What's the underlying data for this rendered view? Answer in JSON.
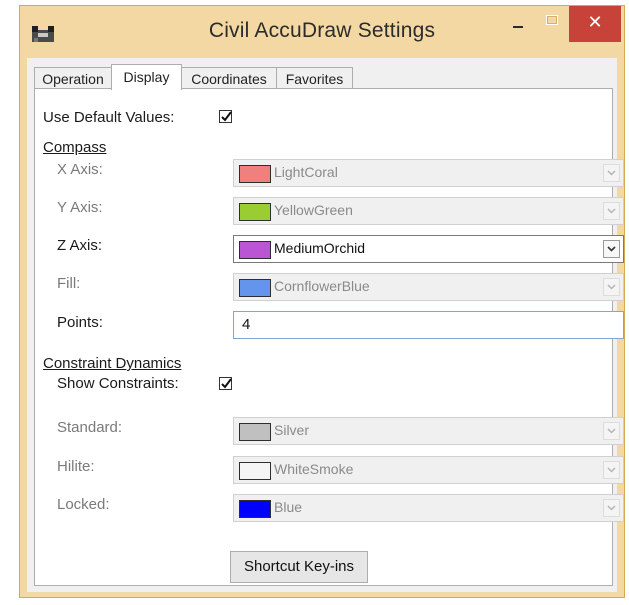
{
  "window": {
    "title": "Civil AccuDraw Settings",
    "minimize_glyph": "–",
    "close_glyph": "✕"
  },
  "tabs": [
    {
      "label": "Operation",
      "active": false
    },
    {
      "label": "Display",
      "active": true
    },
    {
      "label": "Coordinates",
      "active": false
    },
    {
      "label": "Favorites",
      "active": false
    }
  ],
  "display": {
    "use_default_values": {
      "label": "Use Default Values:",
      "checked": true
    },
    "compass": {
      "heading": "Compass",
      "x_axis": {
        "label": "X Axis:",
        "value": "LightCoral",
        "color": "#f08080",
        "enabled": false
      },
      "y_axis": {
        "label": "Y Axis:",
        "value": "YellowGreen",
        "color": "#9acd32",
        "enabled": false
      },
      "z_axis": {
        "label": "Z Axis:",
        "value": "MediumOrchid",
        "color": "#ba55d3",
        "enabled": true
      },
      "fill": {
        "label": "Fill:",
        "value": "CornflowerBlue",
        "color": "#6495ed",
        "enabled": false
      },
      "points": {
        "label": "Points:",
        "value": "4"
      }
    },
    "constraint_dynamics": {
      "heading": "Constraint Dynamics",
      "show_constraints": {
        "label": "Show Constraints:",
        "checked": true
      },
      "standard": {
        "label": "Standard:",
        "value": "Silver",
        "color": "#c0c0c0",
        "enabled": false
      },
      "hilite": {
        "label": "Hilite:",
        "value": "WhiteSmoke",
        "color": "#f5f5f5",
        "enabled": false
      },
      "locked": {
        "label": "Locked:",
        "value": "Blue",
        "color": "#0000ff",
        "enabled": false
      }
    },
    "shortcut_button": "Shortcut Key-ins"
  },
  "icons": {
    "app": "app-icon",
    "minimize": "minimize-icon",
    "maximize": "maximize-icon",
    "close": "close-icon",
    "dropdown": "chevron-down-icon",
    "check": "checkmark-icon"
  }
}
